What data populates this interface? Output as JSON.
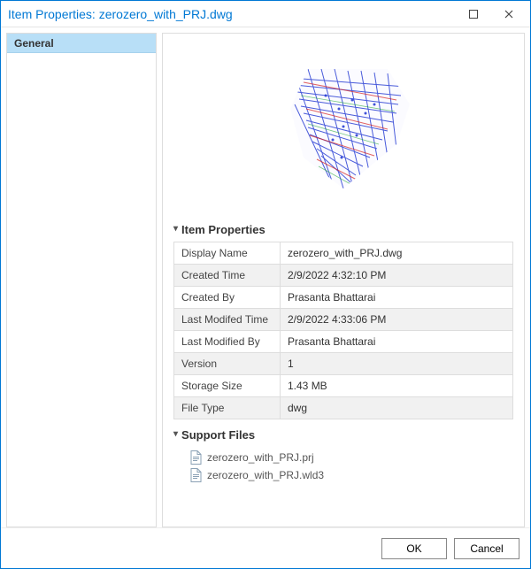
{
  "window": {
    "title": "Item Properties: zerozero_with_PRJ.dwg"
  },
  "sidebar": {
    "tabs": [
      {
        "label": "General"
      }
    ]
  },
  "sections": {
    "properties": {
      "title": "Item Properties",
      "rows": [
        {
          "k": "Display Name",
          "v": "zerozero_with_PRJ.dwg"
        },
        {
          "k": "Created Time",
          "v": "2/9/2022 4:32:10 PM"
        },
        {
          "k": "Created By",
          "v": "Prasanta Bhattarai"
        },
        {
          "k": "Last Modifed Time",
          "v": "2/9/2022 4:33:06 PM"
        },
        {
          "k": "Last Modified By",
          "v": "Prasanta Bhattarai"
        },
        {
          "k": "Version",
          "v": "1"
        },
        {
          "k": "Storage Size",
          "v": "1.43 MB"
        },
        {
          "k": "File Type",
          "v": "dwg"
        }
      ]
    },
    "support": {
      "title": "Support Files",
      "files": [
        {
          "name": "zerozero_with_PRJ.prj"
        },
        {
          "name": "zerozero_with_PRJ.wld3"
        }
      ]
    }
  },
  "buttons": {
    "ok": "OK",
    "cancel": "Cancel"
  },
  "colors": {
    "accent": "#0078d4",
    "thumb_primary": "#2a3fd4",
    "thumb_secondary": "#d62020",
    "thumb_tertiary": "#17a62a"
  }
}
